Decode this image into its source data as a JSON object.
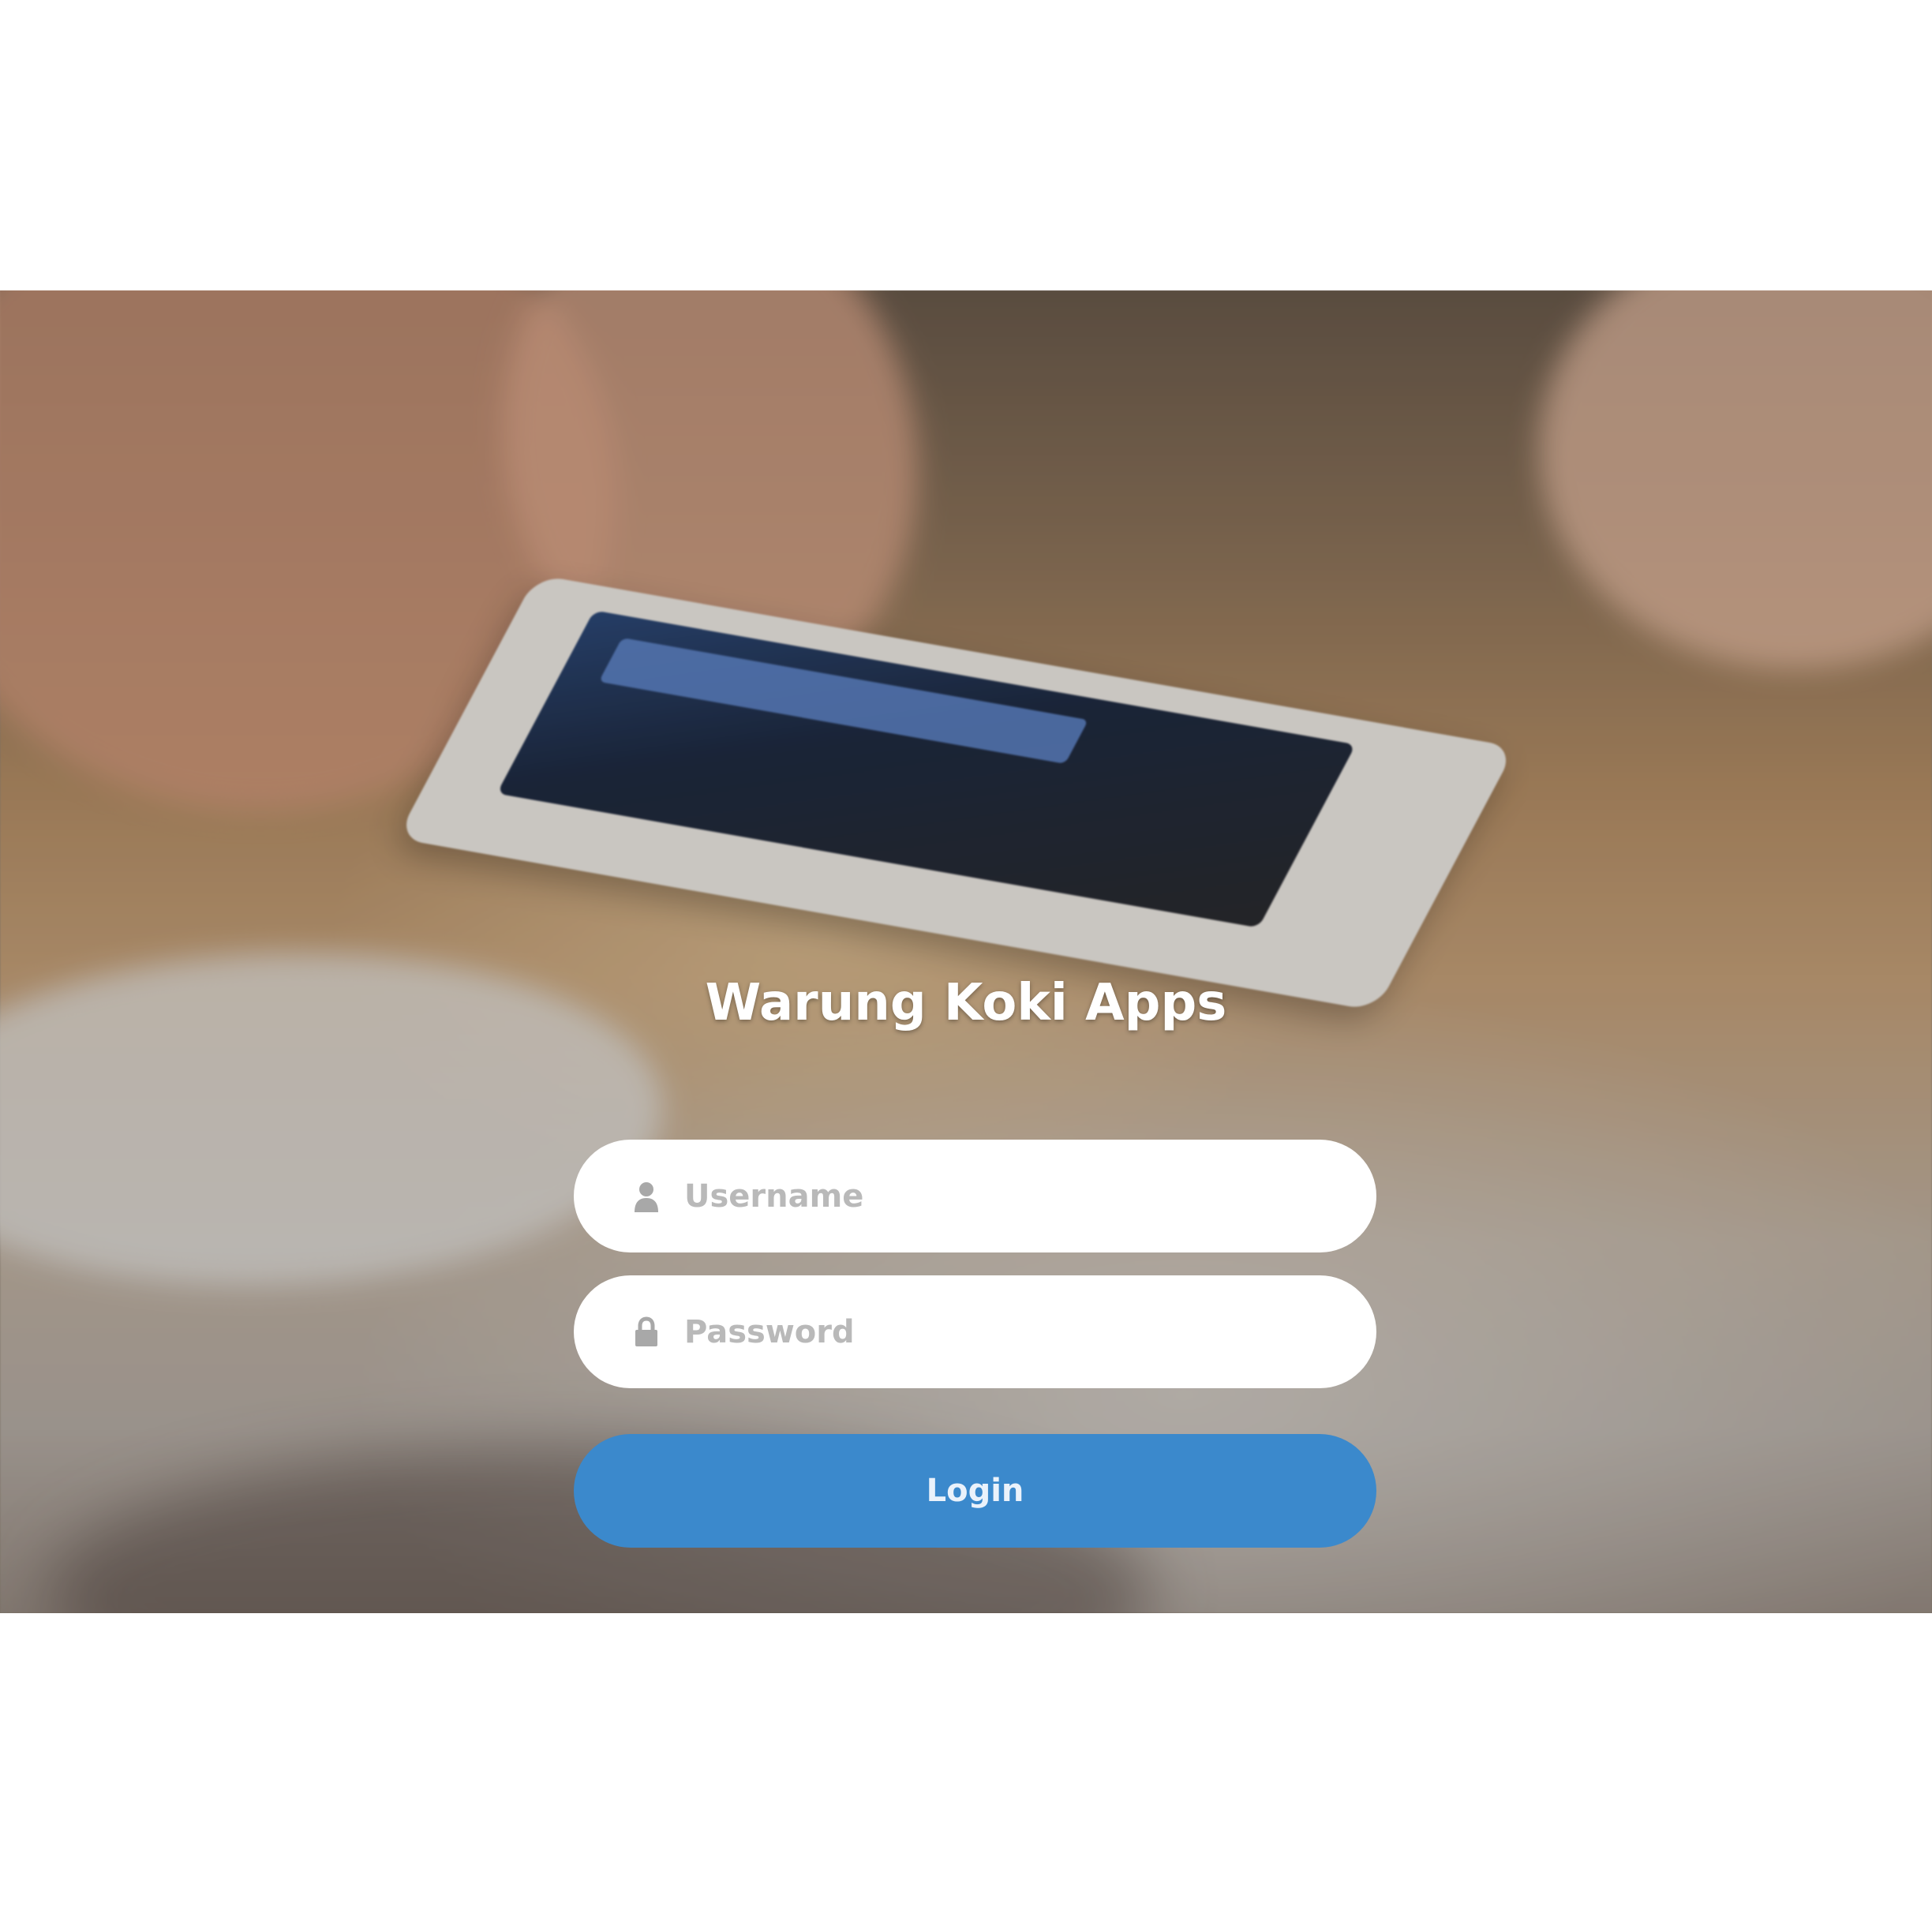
{
  "app": {
    "title": "Warung Koki Apps"
  },
  "form": {
    "username": {
      "placeholder": "Username",
      "value": "",
      "icon": "user-icon"
    },
    "password": {
      "placeholder": "Password",
      "value": "",
      "icon": "lock-icon"
    },
    "login_label": "Login"
  },
  "colors": {
    "accent": "#3b89cc",
    "title_text": "#ffffff",
    "placeholder": "#b9b9b9",
    "field_background": "#ffffff"
  }
}
